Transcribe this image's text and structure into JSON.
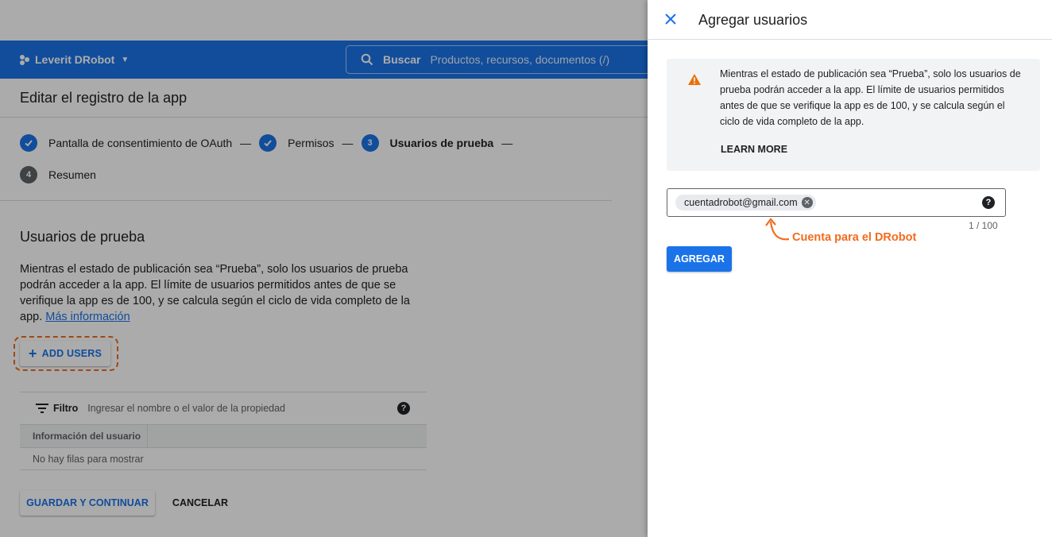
{
  "header": {
    "project_name": "Leverit DRobot",
    "search_label": "Buscar",
    "search_placeholder": "Productos, recursos, documentos (/)"
  },
  "page": {
    "title": "Editar el registro de la app"
  },
  "stepper": {
    "steps": [
      {
        "label": "Pantalla de consentimiento de OAuth",
        "state": "done"
      },
      {
        "label": "Permisos",
        "state": "done"
      },
      {
        "label": "Usuarios de prueba",
        "number": "3",
        "state": "current"
      },
      {
        "label": "Resumen",
        "number": "4",
        "state": "todo"
      }
    ],
    "separator": "—"
  },
  "test_users": {
    "title": "Usuarios de prueba",
    "description": "Mientras el estado de publicación sea “Prueba”, solo los usuarios de prueba podrán acceder a la app. El límite de usuarios permitidos antes de que se verifique la app es de 100, y se calcula según el ciclo de vida completo de la app.",
    "more_info_link": "Más información",
    "add_users_label": "ADD USERS"
  },
  "table": {
    "filter_label": "Filtro",
    "filter_placeholder": "Ingresar el nombre o el valor de la propiedad",
    "help": "?",
    "columns": [
      "Información del usuario"
    ],
    "empty_text": "No hay filas para mostrar"
  },
  "footer": {
    "save_label": "GUARDAR Y CONTINUAR",
    "cancel_label": "CANCELAR"
  },
  "panel": {
    "title": "Agregar usuarios",
    "warning_text": "Mientras el estado de publicación sea “Prueba”, solo los usuarios de prueba podrán acceder a la app. El límite de usuarios permitidos antes de que se verifique la app es de 100, y se calcula según el ciclo de vida completo de la app.",
    "learn_more": "LEARN MORE",
    "chip_value": "cuentadrobot@gmail.com",
    "help": "?",
    "counter": "1 / 100",
    "annotation": "Cuenta para el DRobot",
    "submit_label": "AGREGAR"
  },
  "colors": {
    "primary": "#1a73e8",
    "annotation": "#f26b1d",
    "warning": "#e8710a"
  }
}
